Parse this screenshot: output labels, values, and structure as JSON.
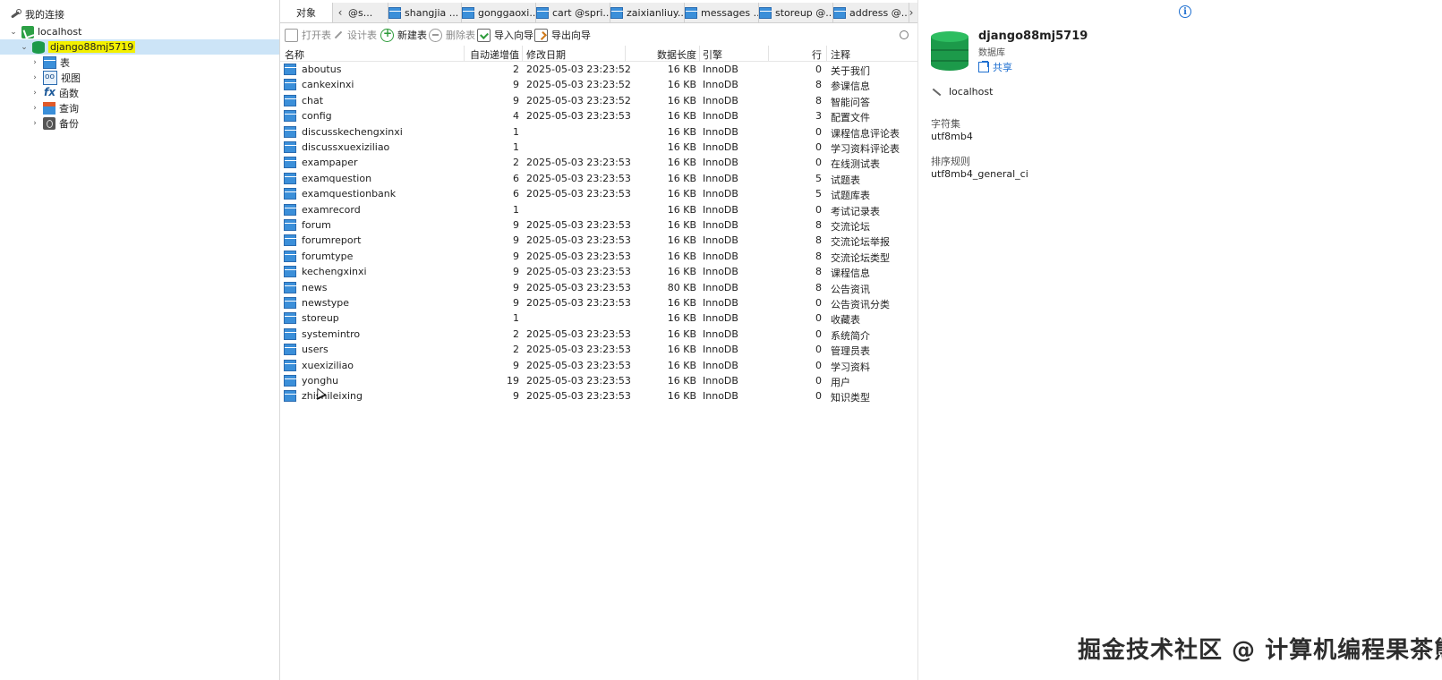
{
  "nav": {
    "root_label": "我的连接",
    "server_label": "localhost",
    "database_label": "django88mj5719",
    "children": [
      {
        "label": "表",
        "icon": "table-icon"
      },
      {
        "label": "视图",
        "icon": "view-icon"
      },
      {
        "label": "函数",
        "icon": "function-icon"
      },
      {
        "label": "查询",
        "icon": "query-icon"
      },
      {
        "label": "备份",
        "icon": "backup-icon"
      }
    ]
  },
  "tabs": {
    "objects_label": "对象",
    "query_tabs": [
      "@s...",
      "shangjia ...",
      "gonggaoxi...",
      "cart @spri...",
      "zaixianliuy...",
      "messages ...",
      "storeup @...",
      "address @..."
    ]
  },
  "toolbar": {
    "open_table": "打开表",
    "design_table": "设计表",
    "new_table": "新建表",
    "delete_table": "删除表",
    "import_wizard": "导入向导",
    "export_wizard": "导出向导"
  },
  "table": {
    "columns": [
      "名称",
      "自动递增值",
      "修改日期",
      "数据长度",
      "引擎",
      "行",
      "注释"
    ],
    "rows": [
      {
        "name": "aboutus",
        "auto_inc": "2",
        "modified": "2025-05-03 23:23:52",
        "size": "16 KB",
        "engine": "InnoDB",
        "rows": "0",
        "comment": "关于我们"
      },
      {
        "name": "cankexinxi",
        "auto_inc": "9",
        "modified": "2025-05-03 23:23:52",
        "size": "16 KB",
        "engine": "InnoDB",
        "rows": "8",
        "comment": "参课信息"
      },
      {
        "name": "chat",
        "auto_inc": "9",
        "modified": "2025-05-03 23:23:52",
        "size": "16 KB",
        "engine": "InnoDB",
        "rows": "8",
        "comment": "智能问答"
      },
      {
        "name": "config",
        "auto_inc": "4",
        "modified": "2025-05-03 23:23:53",
        "size": "16 KB",
        "engine": "InnoDB",
        "rows": "3",
        "comment": "配置文件"
      },
      {
        "name": "discusskechengxinxi",
        "auto_inc": "1",
        "modified": "",
        "size": "16 KB",
        "engine": "InnoDB",
        "rows": "0",
        "comment": "课程信息评论表"
      },
      {
        "name": "discussxuexiziliao",
        "auto_inc": "1",
        "modified": "",
        "size": "16 KB",
        "engine": "InnoDB",
        "rows": "0",
        "comment": "学习资料评论表"
      },
      {
        "name": "exampaper",
        "auto_inc": "2",
        "modified": "2025-05-03 23:23:53",
        "size": "16 KB",
        "engine": "InnoDB",
        "rows": "0",
        "comment": "在线测试表"
      },
      {
        "name": "examquestion",
        "auto_inc": "6",
        "modified": "2025-05-03 23:23:53",
        "size": "16 KB",
        "engine": "InnoDB",
        "rows": "5",
        "comment": "试题表"
      },
      {
        "name": "examquestionbank",
        "auto_inc": "6",
        "modified": "2025-05-03 23:23:53",
        "size": "16 KB",
        "engine": "InnoDB",
        "rows": "5",
        "comment": "试题库表"
      },
      {
        "name": "examrecord",
        "auto_inc": "1",
        "modified": "",
        "size": "16 KB",
        "engine": "InnoDB",
        "rows": "0",
        "comment": "考试记录表"
      },
      {
        "name": "forum",
        "auto_inc": "9",
        "modified": "2025-05-03 23:23:53",
        "size": "16 KB",
        "engine": "InnoDB",
        "rows": "8",
        "comment": "交流论坛"
      },
      {
        "name": "forumreport",
        "auto_inc": "9",
        "modified": "2025-05-03 23:23:53",
        "size": "16 KB",
        "engine": "InnoDB",
        "rows": "8",
        "comment": "交流论坛举报"
      },
      {
        "name": "forumtype",
        "auto_inc": "9",
        "modified": "2025-05-03 23:23:53",
        "size": "16 KB",
        "engine": "InnoDB",
        "rows": "8",
        "comment": "交流论坛类型"
      },
      {
        "name": "kechengxinxi",
        "auto_inc": "9",
        "modified": "2025-05-03 23:23:53",
        "size": "16 KB",
        "engine": "InnoDB",
        "rows": "8",
        "comment": "课程信息"
      },
      {
        "name": "news",
        "auto_inc": "9",
        "modified": "2025-05-03 23:23:53",
        "size": "80 KB",
        "engine": "InnoDB",
        "rows": "8",
        "comment": "公告资讯"
      },
      {
        "name": "newstype",
        "auto_inc": "9",
        "modified": "2025-05-03 23:23:53",
        "size": "16 KB",
        "engine": "InnoDB",
        "rows": "0",
        "comment": "公告资讯分类"
      },
      {
        "name": "storeup",
        "auto_inc": "1",
        "modified": "",
        "size": "16 KB",
        "engine": "InnoDB",
        "rows": "0",
        "comment": "收藏表"
      },
      {
        "name": "systemintro",
        "auto_inc": "2",
        "modified": "2025-05-03 23:23:53",
        "size": "16 KB",
        "engine": "InnoDB",
        "rows": "0",
        "comment": "系统简介"
      },
      {
        "name": "users",
        "auto_inc": "2",
        "modified": "2025-05-03 23:23:53",
        "size": "16 KB",
        "engine": "InnoDB",
        "rows": "0",
        "comment": "管理员表"
      },
      {
        "name": "xuexiziliao",
        "auto_inc": "9",
        "modified": "2025-05-03 23:23:53",
        "size": "16 KB",
        "engine": "InnoDB",
        "rows": "0",
        "comment": "学习资料"
      },
      {
        "name": "yonghu",
        "auto_inc": "19",
        "modified": "2025-05-03 23:23:53",
        "size": "16 KB",
        "engine": "InnoDB",
        "rows": "0",
        "comment": "用户"
      },
      {
        "name": "zhishileixing",
        "auto_inc": "9",
        "modified": "2025-05-03 23:23:53",
        "size": "16 KB",
        "engine": "InnoDB",
        "rows": "0",
        "comment": "知识类型"
      }
    ]
  },
  "info": {
    "db_name": "django88mj5719",
    "db_type": "数据库",
    "share_label": "共享",
    "host": "localhost",
    "charset_label": "字符集",
    "charset_value": "utf8mb4",
    "collation_label": "排序规则",
    "collation_value": "utf8mb4_general_ci"
  },
  "watermark": "掘金技术社区 @ 计算机编程果茶熊",
  "colors": {
    "selection": "#cce4f7",
    "highlight": "#f3f000",
    "db_green": "#1c9a4a",
    "link_blue": "#1e6fd0"
  }
}
